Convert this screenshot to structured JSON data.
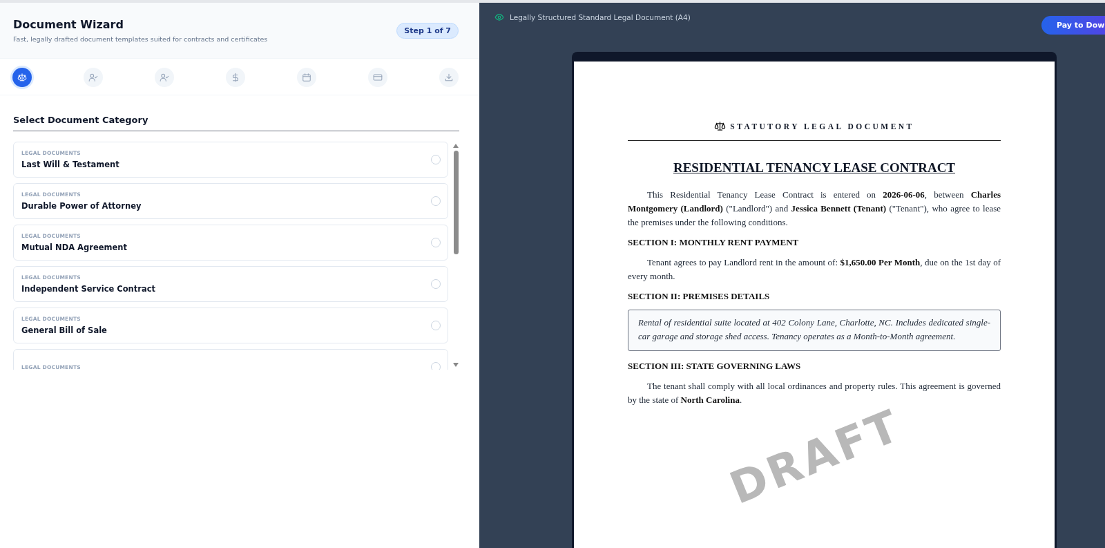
{
  "wizard": {
    "title": "Document Wizard",
    "subtitle": "Fast, legally drafted document templates suited for contracts and certificates",
    "step_badge": "Step 1 of 7",
    "steps": [
      {
        "kind": "scale",
        "selected": true
      },
      {
        "kind": "person",
        "selected": false
      },
      {
        "kind": "person",
        "selected": false
      },
      {
        "kind": "dollar",
        "selected": false
      },
      {
        "kind": "calendar",
        "selected": false
      },
      {
        "kind": "card",
        "selected": false
      },
      {
        "kind": "download",
        "selected": false
      }
    ],
    "section_title": "Select Document Category",
    "documents": [
      {
        "category": "LEGAL DOCUMENTS",
        "title": "Last Will & Testament",
        "selected": false
      },
      {
        "category": "LEGAL DOCUMENTS",
        "title": "Durable Power of Attorney",
        "selected": false
      },
      {
        "category": "LEGAL DOCUMENTS",
        "title": "Mutual NDA Agreement",
        "selected": false
      },
      {
        "category": "LEGAL DOCUMENTS",
        "title": "Independent Service Contract",
        "selected": false
      },
      {
        "category": "LEGAL DOCUMENTS",
        "title": "General Bill of Sale",
        "selected": false
      },
      {
        "category": "LEGAL DOCUMENTS",
        "selected": false
      }
    ]
  },
  "preview": {
    "label": "Legally Structured Standard Legal Document (A4)",
    "pay_button": "Pay to Dow",
    "document": {
      "header": "STATUTORY LEGAL DOCUMENT",
      "title": "RESIDENTIAL TENANCY LEASE CONTRACT",
      "watermark": "DRAFT",
      "blocks": [
        {
          "kind": "paragraph",
          "text": "This Residential Tenancy Lease Contract is entered on **2026-06-06**, between **Charles Montgomery (Landlord)** (\"Landlord\") and **Jessica Bennett (Tenant)** (\"Tenant\"), who agree to lease the premises under the following conditions."
        },
        {
          "kind": "heading",
          "text": "SECTION I: MONTHLY RENT PAYMENT"
        },
        {
          "kind": "paragraph",
          "text": "Tenant agrees to pay Landlord rent in the amount of: **$1,650.00 Per Month**, due on the 1st day of every month."
        },
        {
          "kind": "heading",
          "text": "SECTION II: PREMISES DETAILS"
        },
        {
          "kind": "box",
          "text": "Rental of residential suite located at 402 Colony Lane, Charlotte, NC. Includes dedicated single-car garage and storage shed access. Tenancy operates as a Month-to-Month agreement."
        },
        {
          "kind": "heading",
          "text": "SECTION III: STATE GOVERNING LAWS"
        },
        {
          "kind": "paragraph",
          "text": "The tenant shall comply with all local ordinances and property rules. This agreement is governed by the state of **North Carolina**."
        }
      ]
    }
  }
}
